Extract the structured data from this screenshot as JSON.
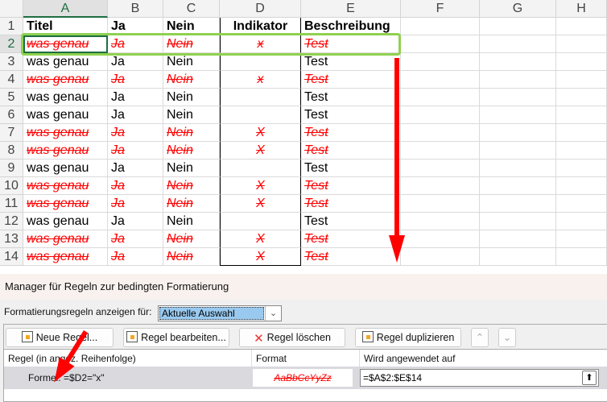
{
  "columns": [
    "A",
    "B",
    "C",
    "D",
    "E",
    "F",
    "G",
    "H"
  ],
  "rows": [
    {
      "n": "1",
      "cells": [
        "Titel",
        "Ja",
        "Nein",
        "Indikator",
        "Beschreibung"
      ],
      "header": true
    },
    {
      "n": "2",
      "cells": [
        "was genau",
        "Ja",
        "Nein",
        "x",
        "Test"
      ],
      "hit": true
    },
    {
      "n": "3",
      "cells": [
        "was genau",
        "Ja",
        "Nein",
        "",
        "Test"
      ]
    },
    {
      "n": "4",
      "cells": [
        "was genau",
        "Ja",
        "Nein",
        "x",
        "Test"
      ],
      "hit": true
    },
    {
      "n": "5",
      "cells": [
        "was genau",
        "Ja",
        "Nein",
        "",
        "Test"
      ]
    },
    {
      "n": "6",
      "cells": [
        "was genau",
        "Ja",
        "Nein",
        "",
        "Test"
      ]
    },
    {
      "n": "7",
      "cells": [
        "was genau",
        "Ja",
        "Nein",
        "X",
        "Test"
      ],
      "hit": true
    },
    {
      "n": "8",
      "cells": [
        "was genau",
        "Ja",
        "Nein",
        "X",
        "Test"
      ],
      "hit": true
    },
    {
      "n": "9",
      "cells": [
        "was genau",
        "Ja",
        "Nein",
        "",
        "Test"
      ]
    },
    {
      "n": "10",
      "cells": [
        "was genau",
        "Ja",
        "Nein",
        "X",
        "Test"
      ],
      "hit": true
    },
    {
      "n": "11",
      "cells": [
        "was genau",
        "Ja",
        "Nein",
        "X",
        "Test"
      ],
      "hit": true
    },
    {
      "n": "12",
      "cells": [
        "was genau",
        "Ja",
        "Nein",
        "",
        "Test"
      ]
    },
    {
      "n": "13",
      "cells": [
        "was genau",
        "Ja",
        "Nein",
        "X",
        "Test"
      ],
      "hit": true
    },
    {
      "n": "14",
      "cells": [
        "was genau",
        "Ja",
        "Nein",
        "X",
        "Test"
      ],
      "hit": true
    }
  ],
  "dialog": {
    "title": "Manager für Regeln zur bedingten Formatierung",
    "show_for_label": "Formatierungsregeln anzeigen für:",
    "show_for_value": "Aktuelle Auswahl",
    "buttons": {
      "new": "Neue Regel...",
      "edit": "Regel bearbeiten...",
      "delete": "Regel löschen",
      "duplicate": "Regel duplizieren"
    },
    "headers": {
      "rule": "Regel (in angez. Reihenfolge)",
      "format": "Format",
      "applies": "Wird angewendet auf"
    },
    "rule": {
      "formula": "Formel: =$D2=\"x\"",
      "preview": "AaBbCcYyZz",
      "applies_to": "=$A$2:$E$14"
    }
  },
  "colors": {
    "strike": "#ff0000",
    "highlight": "#8fd14f",
    "selection": "#99c9ef"
  }
}
